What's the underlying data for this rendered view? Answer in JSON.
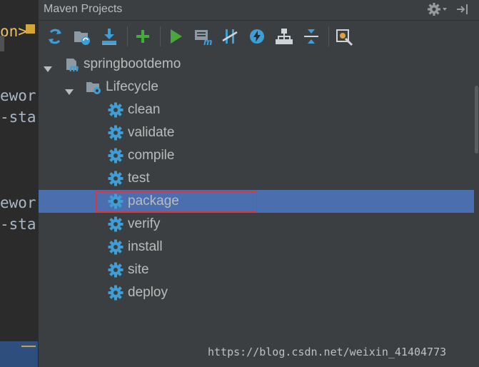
{
  "editor": {
    "lines": [
      "on>",
      "ewor",
      "-sta",
      "ewor",
      "-sta"
    ]
  },
  "panel": {
    "title": "Maven Projects"
  },
  "toolbar": {
    "buttons": [
      {
        "name": "reimport-icon"
      },
      {
        "name": "generate-sources-icon"
      },
      {
        "name": "download-icon"
      },
      {
        "name": "add-icon"
      },
      {
        "name": "run-icon"
      },
      {
        "name": "execute-goal-icon"
      },
      {
        "name": "toggle-offline-icon"
      },
      {
        "name": "skip-tests-icon"
      },
      {
        "name": "show-dependencies-icon"
      },
      {
        "name": "collapse-all-icon"
      },
      {
        "name": "settings-icon"
      }
    ]
  },
  "tree": {
    "project": "springbootdemo",
    "lifecycle": "Lifecycle",
    "goals": [
      "clean",
      "validate",
      "compile",
      "test",
      "package",
      "verify",
      "install",
      "site",
      "deploy"
    ],
    "selected": "package"
  },
  "watermark": "https://blog.csdn.net/weixin_41404773",
  "colors": {
    "background": "#3c3f41",
    "selection": "#4b6eaf",
    "gear": "#3d9fd6",
    "highlight_border": "#e0323a"
  }
}
